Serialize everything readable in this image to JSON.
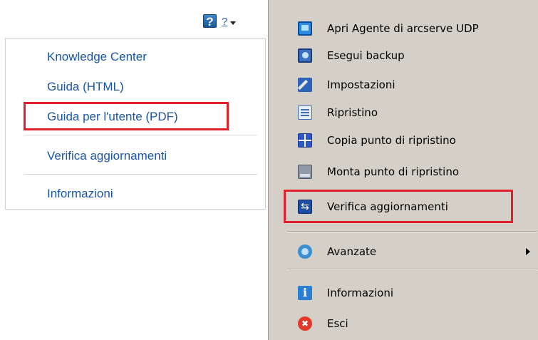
{
  "help_header": {
    "help_icon": "help-icon",
    "mini_help_label": "?",
    "mini_help_arrow_icon": "chevron-down-icon"
  },
  "help_menu": {
    "items": [
      {
        "label": "Knowledge Center"
      },
      {
        "label": "Guida (HTML)"
      },
      {
        "label": "Guida per l'utente (PDF)"
      },
      {
        "label": "Verifica aggiornamenti"
      },
      {
        "label": "Informazioni"
      }
    ]
  },
  "context_menu": {
    "items": [
      {
        "label": "Apri Agente di arcserve UDP",
        "icon": "monitor-icon"
      },
      {
        "label": "Esegui backup",
        "icon": "backup-icon"
      },
      {
        "label": "Impostazioni",
        "icon": "wrench-icon"
      },
      {
        "label": "Ripristino",
        "icon": "restore-icon"
      },
      {
        "label": "Copia punto di ripristino",
        "icon": "grid-icon"
      },
      {
        "label": "Monta punto di ripristino",
        "icon": "mount-icon"
      },
      {
        "label": "Verifica aggiornamenti",
        "icon": "update-icon"
      },
      {
        "label": "Avanzate",
        "icon": "advanced-icon",
        "has_submenu": true
      },
      {
        "label": "Informazioni",
        "icon": "info-icon"
      },
      {
        "label": "Esci",
        "icon": "exit-icon"
      }
    ]
  },
  "colors": {
    "highlight": "#e0202a",
    "link": "#1a56a8",
    "menu_bg": "#d4d0c8"
  }
}
